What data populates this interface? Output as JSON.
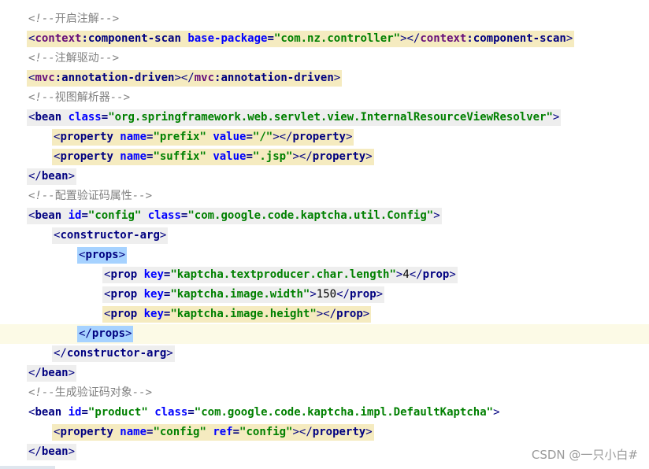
{
  "code": {
    "lines": [
      {
        "id": "l1",
        "indent": 0,
        "hl": "none",
        "tokens": [
          [
            "t-comment",
            "<!--"
          ],
          [
            "t-comment-cn",
            "开启注解"
          ],
          [
            "t-comment",
            "-->"
          ]
        ]
      },
      {
        "id": "l2",
        "indent": 0,
        "hl": "yellow",
        "tokens": [
          [
            "t-punct",
            "<"
          ],
          [
            "t-ns",
            "context"
          ],
          [
            "t-tag",
            ":component-scan "
          ],
          [
            "t-attr",
            "base-package"
          ],
          [
            "t-tag",
            "="
          ],
          [
            "t-val",
            "\"com.nz.controller\""
          ],
          [
            "t-punct",
            "></"
          ],
          [
            "t-ns",
            "context"
          ],
          [
            "t-tag",
            ":component-scan"
          ],
          [
            "t-punct",
            ">"
          ]
        ]
      },
      {
        "id": "l3",
        "indent": 0,
        "hl": "none",
        "tokens": [
          [
            "t-comment",
            "<!--"
          ],
          [
            "t-comment-cn",
            "注解驱动"
          ],
          [
            "t-comment",
            "-->"
          ]
        ]
      },
      {
        "id": "l4",
        "indent": 0,
        "hl": "yellow",
        "tokens": [
          [
            "t-punct",
            "<"
          ],
          [
            "t-ns",
            "mvc"
          ],
          [
            "t-tag",
            ":annotation-driven"
          ],
          [
            "t-punct",
            "></"
          ],
          [
            "t-ns",
            "mvc"
          ],
          [
            "t-tag",
            ":annotation-driven"
          ],
          [
            "t-punct",
            ">"
          ]
        ]
      },
      {
        "id": "l5",
        "indent": 0,
        "hl": "none",
        "tokens": [
          [
            "t-comment",
            "<!--"
          ],
          [
            "t-comment-cn",
            "视图解析器"
          ],
          [
            "t-comment",
            "-->"
          ]
        ]
      },
      {
        "id": "l6",
        "indent": 0,
        "hl": "gray",
        "tokens": [
          [
            "t-punct",
            "<"
          ],
          [
            "t-tag",
            "bean "
          ],
          [
            "t-attr",
            "class"
          ],
          [
            "t-tag",
            "="
          ],
          [
            "t-val",
            "\"org.springframework.web.servlet.view.InternalResourceViewResolver\""
          ],
          [
            "t-punct",
            ">"
          ]
        ]
      },
      {
        "id": "l7",
        "indent": 1,
        "hl": "yellow",
        "tokens": [
          [
            "t-punct",
            "<"
          ],
          [
            "t-tag",
            "property "
          ],
          [
            "t-attr",
            "name"
          ],
          [
            "t-tag",
            "="
          ],
          [
            "t-val",
            "\"prefix\" "
          ],
          [
            "t-attr",
            "value"
          ],
          [
            "t-tag",
            "="
          ],
          [
            "t-val",
            "\"/\""
          ],
          [
            "t-punct",
            "></"
          ],
          [
            "t-tag",
            "property"
          ],
          [
            "t-punct",
            ">"
          ]
        ]
      },
      {
        "id": "l8",
        "indent": 1,
        "hl": "yellow",
        "tokens": [
          [
            "t-punct",
            "<"
          ],
          [
            "t-tag",
            "property "
          ],
          [
            "t-attr",
            "name"
          ],
          [
            "t-tag",
            "="
          ],
          [
            "t-val",
            "\"suffix\" "
          ],
          [
            "t-attr",
            "value"
          ],
          [
            "t-tag",
            "="
          ],
          [
            "t-val",
            "\".jsp\""
          ],
          [
            "t-punct",
            "></"
          ],
          [
            "t-tag",
            "property"
          ],
          [
            "t-punct",
            ">"
          ]
        ]
      },
      {
        "id": "l9",
        "indent": 0,
        "hl": "gray",
        "tokens": [
          [
            "t-punct",
            "</"
          ],
          [
            "t-tag",
            "bean"
          ],
          [
            "t-punct",
            ">"
          ]
        ]
      },
      {
        "id": "l10",
        "indent": 0,
        "hl": "none",
        "tokens": [
          [
            "t-comment",
            "<!--"
          ],
          [
            "t-comment-cn",
            "配置验证码属性"
          ],
          [
            "t-comment",
            "-->"
          ]
        ]
      },
      {
        "id": "l11",
        "indent": 0,
        "hl": "gray",
        "tokens": [
          [
            "t-punct",
            "<"
          ],
          [
            "t-tag",
            "bean "
          ],
          [
            "t-attr",
            "id"
          ],
          [
            "t-tag",
            "="
          ],
          [
            "t-val",
            "\"config\" "
          ],
          [
            "t-attr",
            "class"
          ],
          [
            "t-tag",
            "="
          ],
          [
            "t-val",
            "\"com.google.code.kaptcha.util.Config\""
          ],
          [
            "t-punct",
            ">"
          ]
        ]
      },
      {
        "id": "l12",
        "indent": 1,
        "hl": "gray",
        "tokens": [
          [
            "t-punct",
            "<"
          ],
          [
            "t-tag",
            "constructor-arg"
          ],
          [
            "t-punct",
            ">"
          ]
        ]
      },
      {
        "id": "l13",
        "indent": 2,
        "hl": "blue",
        "tokens": [
          [
            "t-punct",
            "<"
          ],
          [
            "t-tag",
            "props"
          ],
          [
            "t-punct",
            ">"
          ]
        ]
      },
      {
        "id": "l14",
        "indent": 3,
        "hl": "gray",
        "tokens": [
          [
            "t-punct",
            "<"
          ],
          [
            "t-tag",
            "prop "
          ],
          [
            "t-attr",
            "key"
          ],
          [
            "t-tag",
            "="
          ],
          [
            "t-val",
            "\"kaptcha.textproducer.char.length\""
          ],
          [
            "t-punct",
            ">"
          ],
          [
            "t-text",
            "4"
          ],
          [
            "t-punct",
            "</"
          ],
          [
            "t-tag",
            "prop"
          ],
          [
            "t-punct",
            ">"
          ]
        ]
      },
      {
        "id": "l15",
        "indent": 3,
        "hl": "gray",
        "tokens": [
          [
            "t-punct",
            "<"
          ],
          [
            "t-tag",
            "prop "
          ],
          [
            "t-attr",
            "key"
          ],
          [
            "t-tag",
            "="
          ],
          [
            "t-val",
            "\"kaptcha.image.width\""
          ],
          [
            "t-punct",
            ">"
          ],
          [
            "t-text",
            "150"
          ],
          [
            "t-punct",
            "</"
          ],
          [
            "t-tag",
            "prop"
          ],
          [
            "t-punct",
            ">"
          ]
        ]
      },
      {
        "id": "l16",
        "indent": 3,
        "hl": "yellow",
        "tokens": [
          [
            "t-punct",
            "<"
          ],
          [
            "t-tag",
            "prop "
          ],
          [
            "t-attr",
            "key"
          ],
          [
            "t-tag",
            "="
          ],
          [
            "t-val",
            "\"kaptcha.image.height\""
          ],
          [
            "t-punct",
            "></"
          ],
          [
            "t-tag",
            "prop"
          ],
          [
            "t-punct",
            ">"
          ]
        ]
      },
      {
        "id": "l17",
        "indent": 2,
        "hl": "blue",
        "caret": true,
        "tokens": [
          [
            "t-punct",
            "</"
          ],
          [
            "t-tag",
            "props"
          ],
          [
            "t-punct",
            ">"
          ]
        ]
      },
      {
        "id": "l18",
        "indent": 1,
        "hl": "gray",
        "tokens": [
          [
            "t-punct",
            "</"
          ],
          [
            "t-tag",
            "constructor-arg"
          ],
          [
            "t-punct",
            ">"
          ]
        ]
      },
      {
        "id": "l19",
        "indent": 0,
        "hl": "gray",
        "tokens": [
          [
            "t-punct",
            "</"
          ],
          [
            "t-tag",
            "bean"
          ],
          [
            "t-punct",
            ">"
          ]
        ]
      },
      {
        "id": "l20",
        "indent": 0,
        "hl": "none",
        "tokens": [
          [
            "t-comment",
            "<!--"
          ],
          [
            "t-comment-cn",
            "生成验证码对象"
          ],
          [
            "t-comment",
            "-->"
          ]
        ]
      },
      {
        "id": "l21",
        "indent": 0,
        "hl": "none",
        "tokens": [
          [
            "t-punct",
            "<"
          ],
          [
            "t-tag",
            "bean "
          ],
          [
            "t-attr",
            "id"
          ],
          [
            "t-tag",
            "="
          ],
          [
            "t-val",
            "\"product\" "
          ],
          [
            "t-attr",
            "class"
          ],
          [
            "t-tag",
            "="
          ],
          [
            "t-val",
            "\"com.google.code.kaptcha.impl.DefaultKaptcha\""
          ],
          [
            "t-punct",
            ">"
          ]
        ]
      },
      {
        "id": "l22",
        "indent": 1,
        "hl": "yellow",
        "tokens": [
          [
            "t-punct",
            "<"
          ],
          [
            "t-tag",
            "property "
          ],
          [
            "t-attr",
            "name"
          ],
          [
            "t-tag",
            "="
          ],
          [
            "t-val",
            "\"config\" "
          ],
          [
            "t-attr",
            "ref"
          ],
          [
            "t-tag",
            "="
          ],
          [
            "t-val",
            "\"config\""
          ],
          [
            "t-punct",
            "></"
          ],
          [
            "t-tag",
            "property"
          ],
          [
            "t-punct",
            ">"
          ]
        ]
      },
      {
        "id": "l23",
        "indent": 0,
        "hl": "gray",
        "tokens": [
          [
            "t-punct",
            "</"
          ],
          [
            "t-tag",
            "bean"
          ],
          [
            "t-punct",
            ">"
          ]
        ]
      }
    ]
  },
  "watermark": "CSDN @一只小白#"
}
